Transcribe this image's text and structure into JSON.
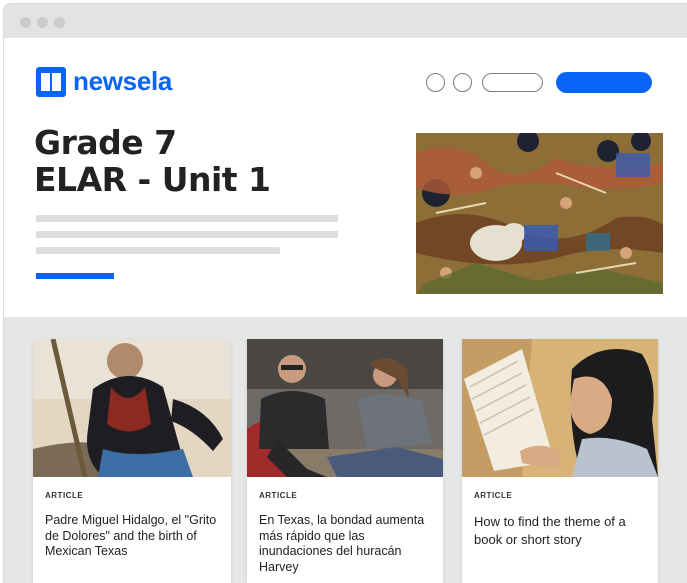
{
  "brand": {
    "name": "newsela",
    "color": "#0a64f5"
  },
  "hero": {
    "title_line1": "Grade 7",
    "title_line2": "ELAR - Unit 1"
  },
  "cards": [
    {
      "type": "ARTICLE",
      "title": "Padre Miguel Hidalgo, el \"Grito de Dolores\" and the birth of Mexican Texas"
    },
    {
      "type": "ARTICLE",
      "title": "En Texas, la bondad aumenta más rápido que las inundaciones del huracán Harvey"
    },
    {
      "type": "ARTICLE",
      "title": "How to find the theme of a book or short story"
    }
  ]
}
